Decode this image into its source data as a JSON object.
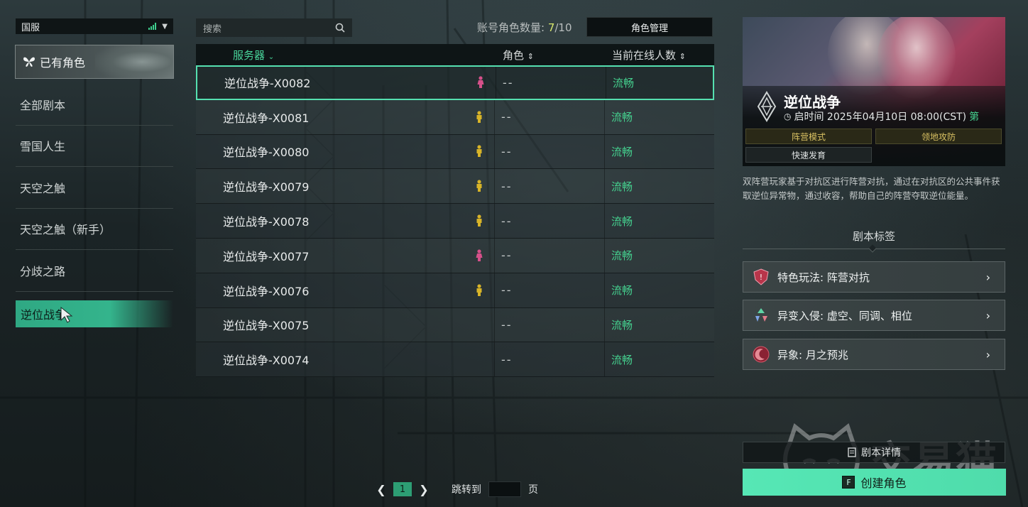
{
  "region": {
    "label": "国服",
    "signal_color": "#3ecf8e"
  },
  "sidebar": {
    "my_roles_label": "已有角色",
    "items": [
      {
        "label": "全部剧本"
      },
      {
        "label": "雪国人生"
      },
      {
        "label": "天空之触"
      },
      {
        "label": "天空之触（新手）"
      },
      {
        "label": "分歧之路"
      }
    ],
    "active_item": {
      "label": "逆位战争"
    }
  },
  "search": {
    "placeholder": "搜索"
  },
  "account": {
    "label": "账号角色数量: ",
    "count": "7",
    "max": "/10"
  },
  "role_management_button": "角色管理",
  "table": {
    "headers": {
      "server": "服务器",
      "role": "角色",
      "online": "当前在线人数"
    },
    "rows": [
      {
        "name": "逆位战争-X0082",
        "role_icon": "female",
        "role": "--",
        "status": "流畅",
        "selected": true
      },
      {
        "name": "逆位战争-X0081",
        "role_icon": "male",
        "role": "--",
        "status": "流畅"
      },
      {
        "name": "逆位战争-X0080",
        "role_icon": "male",
        "role": "--",
        "status": "流畅"
      },
      {
        "name": "逆位战争-X0079",
        "role_icon": "male",
        "role": "--",
        "status": "流畅"
      },
      {
        "name": "逆位战争-X0078",
        "role_icon": "male",
        "role": "--",
        "status": "流畅"
      },
      {
        "name": "逆位战争-X0077",
        "role_icon": "female",
        "role": "--",
        "status": "流畅"
      },
      {
        "name": "逆位战争-X0076",
        "role_icon": "male",
        "role": "--",
        "status": "流畅"
      },
      {
        "name": "逆位战争-X0075",
        "role_icon": "none",
        "role": "--",
        "status": "流畅"
      },
      {
        "name": "逆位战争-X0074",
        "role_icon": "none",
        "role": "--",
        "status": "流畅"
      }
    ]
  },
  "pager": {
    "current_page": "1",
    "jump_label": "跳转到",
    "page_unit": "页"
  },
  "scenario": {
    "title": "逆位战争",
    "start_time": "启时间 2025年04月10日 08:00(CST)",
    "start_time_extra": "第",
    "tags": [
      "阵营模式",
      "领地攻防",
      "快速发育"
    ],
    "description": "双阵营玩家基于对抗区进行阵营对抗，通过在对抗区的公共事件获取逆位异常物，通过收容，帮助自己的阵营夺取逆位能量。",
    "tags_section_label": "剧本标签",
    "features": [
      {
        "label": "特色玩法: 阵营对抗",
        "icon": "shield-icon"
      },
      {
        "label": "异变入侵: 虚空、同调、相位",
        "icon": "mutation-icon"
      },
      {
        "label": "异象: 月之预兆",
        "icon": "moon-omen-icon"
      }
    ],
    "detail_button": "剧本详情",
    "create_button": "创建角色",
    "create_key": "F"
  },
  "watermark": {
    "text": "交易猫"
  },
  "colors": {
    "accent": "#45d18f",
    "selected_border": "#55e0b0",
    "create_button": "#56e7b5",
    "female_icon": "#d6508a",
    "male_icon": "#d8b428",
    "count_highlight": "#d7e86d"
  }
}
